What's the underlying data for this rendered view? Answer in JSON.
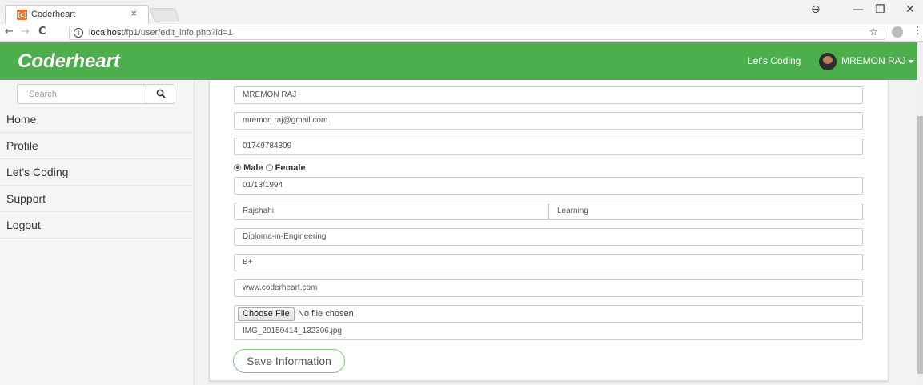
{
  "browser": {
    "tab_title": "Coderheart",
    "tab_close": "×",
    "url_host": "localhost",
    "url_path": "/fp1/user/edit_info.php?id=1",
    "window_controls": [
      "⊖",
      "—",
      "❐",
      "✕"
    ]
  },
  "navbar": {
    "brand": "Coderheart",
    "link": "Let's Coding",
    "user": "MREMON RAJ",
    "accent_color": "#4cae4c"
  },
  "sidebar": {
    "search_placeholder": "Search",
    "items": [
      {
        "label": "Home"
      },
      {
        "label": "Profile"
      },
      {
        "label": "Let's Coding"
      },
      {
        "label": "Support"
      },
      {
        "label": "Logout"
      }
    ]
  },
  "form": {
    "name": "MREMON RAJ",
    "email": "mremon.raj@gmail.com",
    "phone": "01749784809",
    "gender_male": "Male",
    "gender_female": "Female",
    "gender_selected": "Male",
    "birthdate": "01/13/1994",
    "district": "Rajshahi",
    "status": "Learning",
    "education": "Diploma-in-Engineering",
    "blood_group": "B+",
    "website": "www.coderheart.com",
    "file_button": "Choose File",
    "file_status": "No file chosen",
    "current_image": "IMG_20150414_132306.jpg",
    "save_button": "Save Information"
  }
}
